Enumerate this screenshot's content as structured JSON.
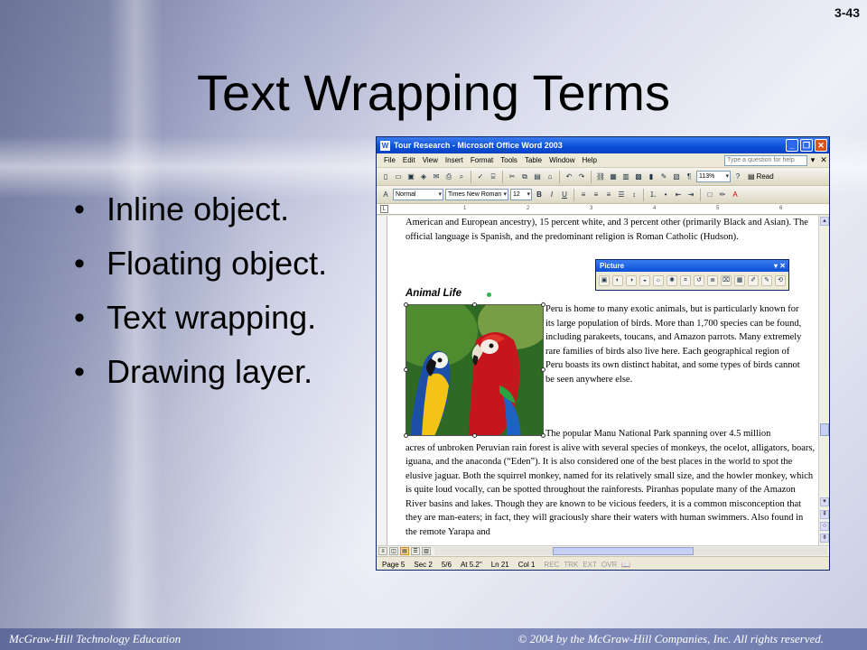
{
  "slide": {
    "number": "3-43",
    "title": "Text Wrapping Terms",
    "bullets": [
      "Inline object.",
      "Floating object.",
      "Text wrapping.",
      "Drawing layer."
    ],
    "footer_left": "McGraw-Hill Technology Education",
    "footer_right": "© 2004 by the McGraw-Hill Companies, Inc.  All rights reserved."
  },
  "word": {
    "window_title": "Tour Research - Microsoft Office Word 2003",
    "menu": [
      "File",
      "Edit",
      "View",
      "Insert",
      "Format",
      "Tools",
      "Table",
      "Window",
      "Help"
    ],
    "help_placeholder": "Type a question for help",
    "zoom": "113%",
    "read_label": "Read",
    "style": "Normal",
    "font": "Times New Roman",
    "font_size": "12",
    "paragraph1": "American and European ancestry), 15 percent white, and 3 percent other (primarily Black and Asian). The official language is Spanish, and the predominant religion is Roman Catholic (Hudson).",
    "heading": "Animal Life",
    "paragraph2": "Peru is home to many exotic animals, but is particularly known for its large population of birds. More than 1,700 species can be found, including parakeets, toucans, and Amazon parrots. Many extremely rare families of birds also live here. Each geographical region of Peru boasts its own distinct habitat, and some types of birds cannot be seen anywhere else.",
    "paragraph3_start": "The popular Manu National Park spanning over 4.5 million",
    "paragraph3_rest": "acres of unbroken Peruvian rain forest is alive with several species of monkeys, the ocelot, alligators, boars, iguana, and the anaconda (“Eden”). It is also considered one of the best places in the world to spot the elusive jaguar. Both the squirrel monkey, named for its relatively small size, and the howler monkey, which is quite loud vocally, can be spotted throughout the rainforests. Piranhas populate many of the Amazon River basins and lakes. Though they are known to be vicious feeders, it is a common misconception that they are man-eaters; in fact, they will graciously share their waters with human swimmers. Also found in the remote Yarapa and",
    "picture_toolbar_title": "Picture",
    "status": {
      "page": "Page 5",
      "sec": "Sec 2",
      "pages": "5/6",
      "at": "At 5.2\"",
      "ln": "Ln 21",
      "col": "Col 1",
      "modes": [
        "REC",
        "TRK",
        "EXT",
        "OVR"
      ]
    }
  },
  "colors": {
    "titlebar": "#0a4fd8",
    "footer_bar": "#6f7bae",
    "macaw_red": "#c4161c",
    "macaw_blue_yellow": "#f3c315"
  }
}
